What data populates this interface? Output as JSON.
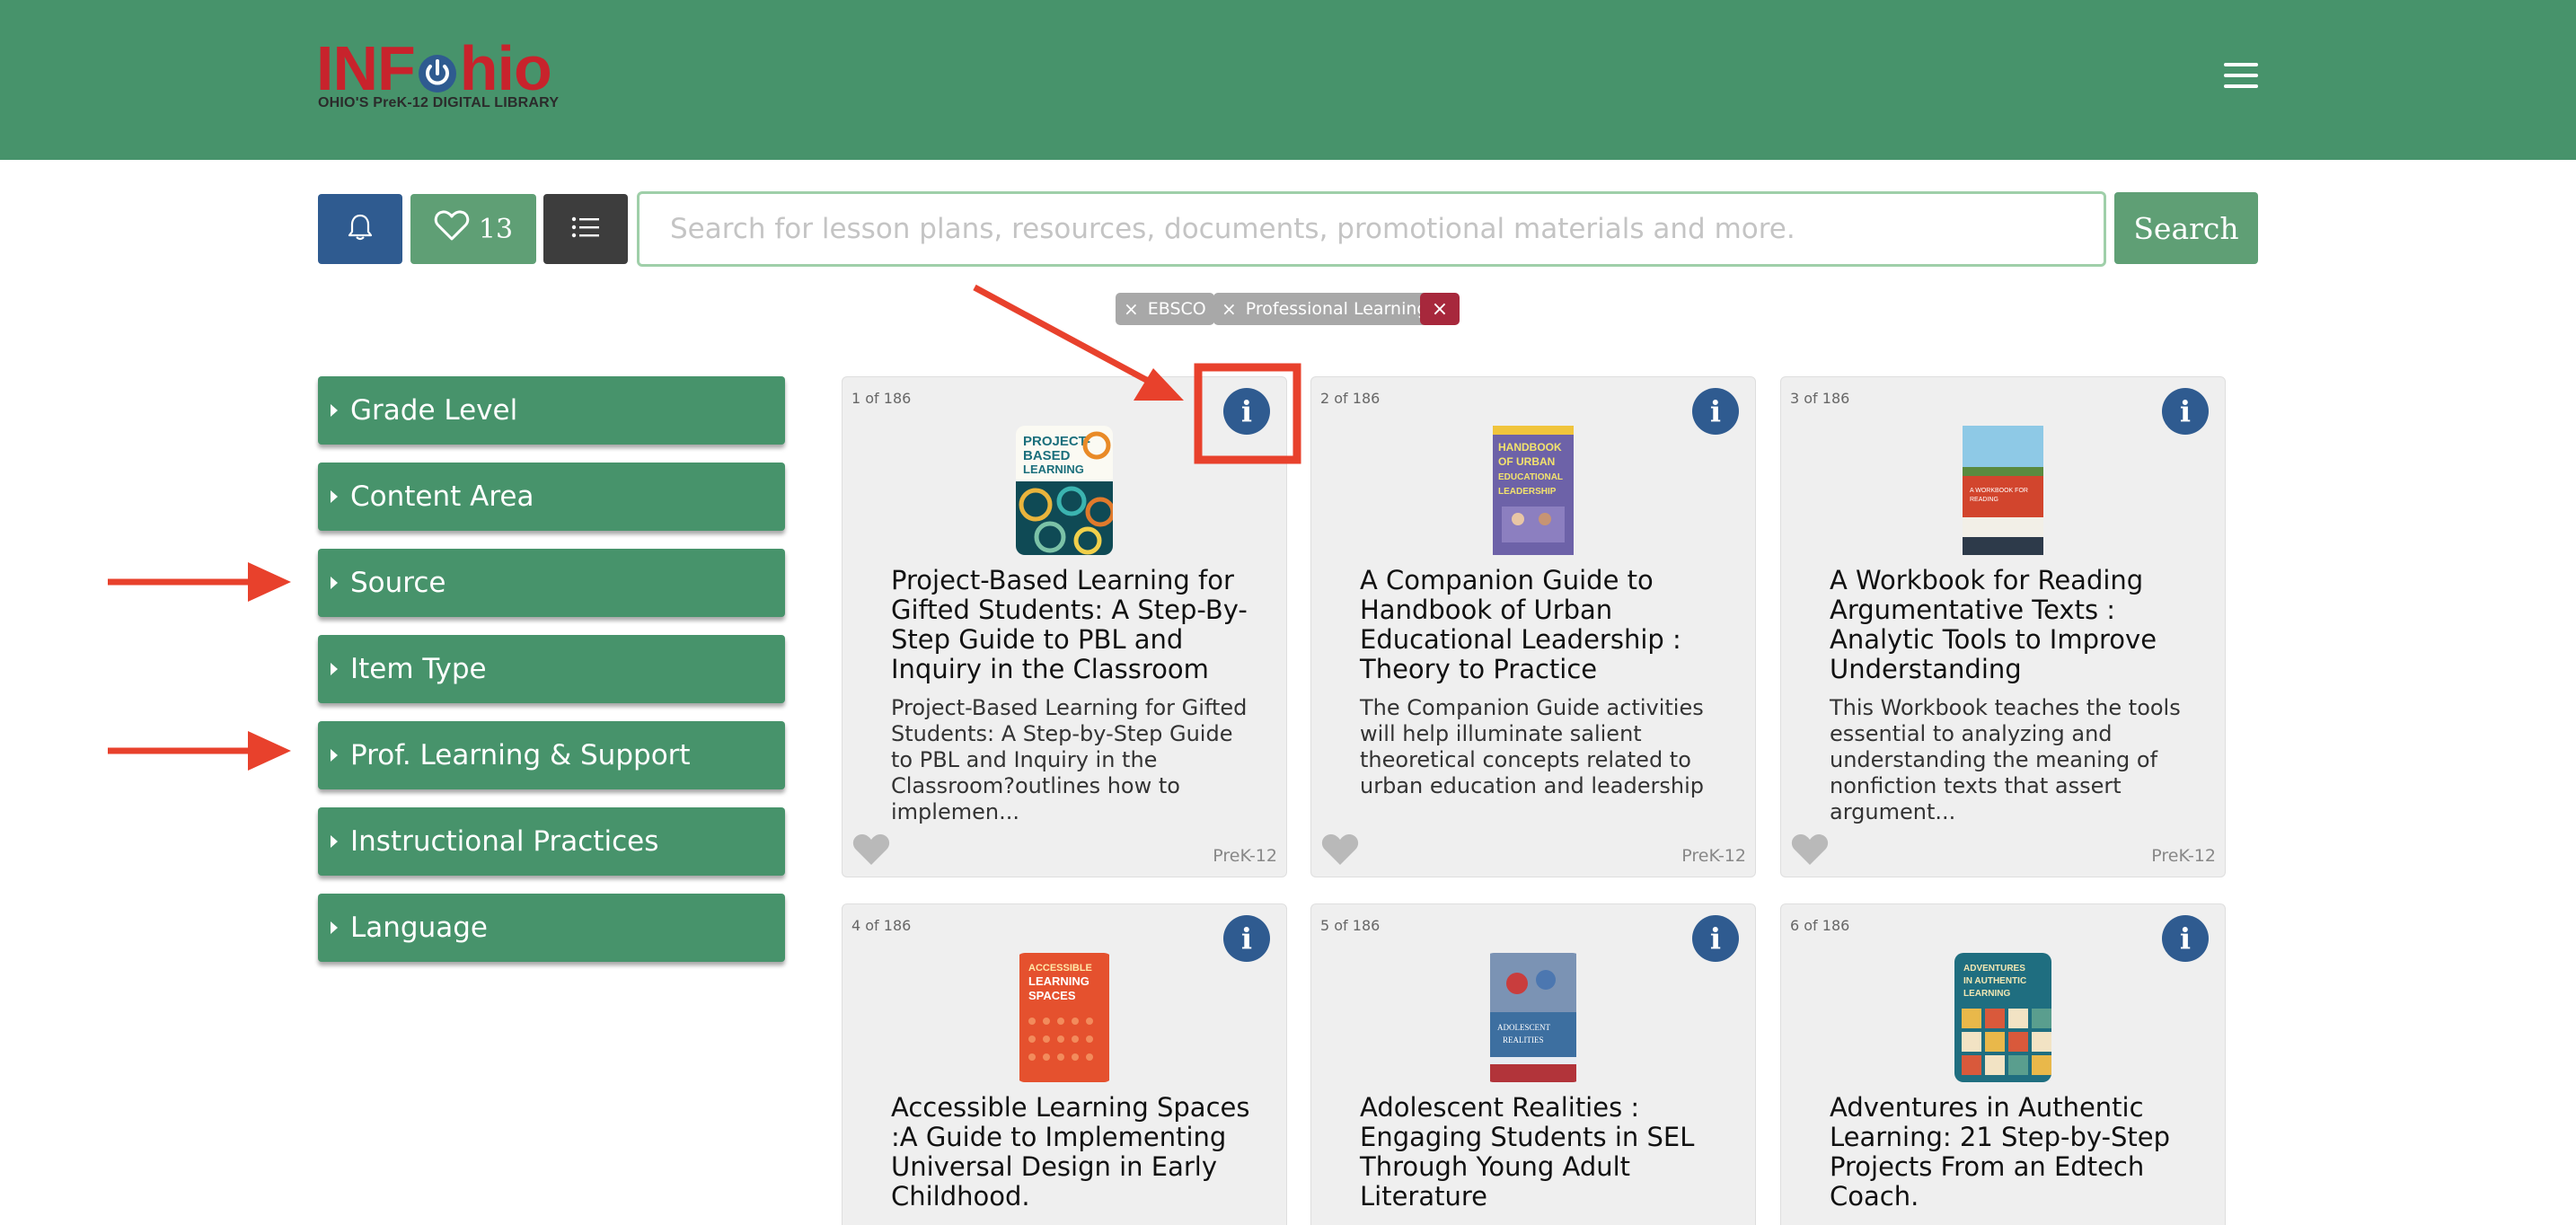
{
  "header": {
    "logo_text_start": "INF",
    "logo_text_end": "hio",
    "logo_tagline": "OHIO'S PreK-12 DIGITAL LIBRARY",
    "menu_icon": "hamburger-menu-icon",
    "background": "#47936b"
  },
  "toolbar": {
    "notifications_icon": "bell-icon",
    "favorites_icon": "heart-icon",
    "favorites_count": "13",
    "list_icon": "list-icon",
    "search_placeholder": "Search for lesson plans, resources, documents, promotional materials and more.",
    "search_value": "",
    "search_label": "Search"
  },
  "filters": {
    "chips": [
      {
        "label": "EBSCO",
        "remove": "×"
      },
      {
        "label": "Professional Learning",
        "remove": "×"
      }
    ],
    "clear_all": "×"
  },
  "sidebar": {
    "facets": [
      {
        "label": "Grade Level"
      },
      {
        "label": "Content Area"
      },
      {
        "label": "Source"
      },
      {
        "label": "Item Type"
      },
      {
        "label": "Prof. Learning & Support"
      },
      {
        "label": "Instructional Practices"
      },
      {
        "label": "Language"
      }
    ]
  },
  "results": {
    "items": [
      {
        "count": "1 of 186",
        "title": "Project-Based Learning for Gifted Students: A Step-By-Step Guide to PBL and Inquiry in the Classroom",
        "description": "Project-Based Learning for Gifted Students: A Step-by-Step Guide to PBL and Inquiry in the Classroom?outlines how to implemen...",
        "grade": "PreK-12",
        "cover_text": "PROJECT-BASED LEARNING"
      },
      {
        "count": "2 of 186",
        "title": "A Companion Guide to Handbook of Urban Educational Leadership : Theory to Practice",
        "description": "The Companion Guide activities will help illuminate salient theoretical concepts related to urban education and leadership",
        "grade": "PreK-12",
        "cover_text": "HANDBOOK OF URBAN EDUCATIONAL LEADERSHIP"
      },
      {
        "count": "3 of 186",
        "title": "A Workbook for Reading Argumentative Texts : Analytic Tools to Improve Understanding",
        "description": "This Workbook teaches the tools essential to analyzing and understanding the meaning of nonfiction texts that assert argument...",
        "grade": "PreK-12",
        "cover_text": "A WORKBOOK FOR READING ARGUMENTATIVE TEXTS"
      },
      {
        "count": "4 of 186",
        "title": "Accessible Learning Spaces :A Guide to Implementing Universal Design in Early Childhood.",
        "description": "",
        "grade": "",
        "cover_text": "ACCESSIBLE LEARNING SPACES"
      },
      {
        "count": "5 of 186",
        "title": "Adolescent Realities : Engaging Students in SEL Through Young Adult Literature",
        "description": "",
        "grade": "",
        "cover_text": "ADOLESCENT REALITIES"
      },
      {
        "count": "6 of 186",
        "title": "Adventures in Authentic Learning: 21 Step-by-Step Projects From an Edtech Coach.",
        "description": "",
        "grade": "",
        "cover_text": "ADVENTURES IN AUTHENTIC LEARNING"
      }
    ],
    "info_icon": "i",
    "favorite_icon": "heart-icon"
  },
  "annotations": {
    "color": "#e8412c",
    "highlight": "info-button-on-first-card",
    "arrows_point_to": [
      "info-button",
      "Source",
      "Prof. Learning & Support"
    ]
  }
}
